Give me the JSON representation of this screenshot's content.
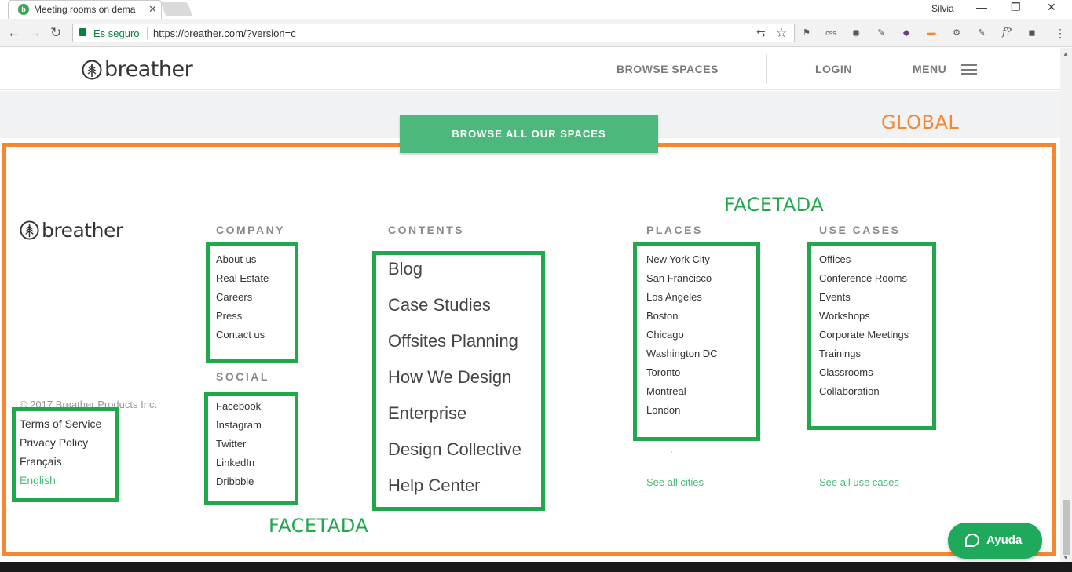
{
  "browser": {
    "tab_title": "Meeting rooms on dema",
    "tab_close": "✕",
    "window_user": "Silvia",
    "window_minimize": "—",
    "window_restore": "❐",
    "window_close": "✕",
    "back": "←",
    "forward": "→",
    "reload": "↻",
    "secure_label": "Es seguro",
    "url": "https://breather.com/?version=c",
    "translate_icon": "⇆",
    "bookmark_icon": "☆",
    "extensions": [
      "⚑",
      "css",
      "◉",
      "✎",
      "◆",
      "▬",
      "⚙",
      "✎",
      "f?",
      "◼",
      "⋮"
    ]
  },
  "header": {
    "logo_text": "breather",
    "browse_spaces": "BROWSE SPACES",
    "login": "LOGIN",
    "menu": "MENU"
  },
  "cta": {
    "browse_all": "BROWSE ALL OUR SPACES"
  },
  "footer": {
    "logo_text": "breather",
    "copyright": "© 2017 Breather Products Inc.",
    "legal": [
      "Terms of Service",
      "Privacy Policy",
      "Français",
      "English"
    ],
    "company": {
      "heading": "COMPANY",
      "items": [
        "About us",
        "Real Estate",
        "Careers",
        "Press",
        "Contact us"
      ]
    },
    "social": {
      "heading": "SOCIAL",
      "items": [
        "Facebook",
        "Instagram",
        "Twitter",
        "LinkedIn",
        "Dribbble"
      ]
    },
    "contents": {
      "heading": "CONTENTS",
      "items": [
        "Blog",
        "Case Studies",
        "Offsites Planning",
        "How We Design",
        "Enterprise",
        "Design Collective",
        "Help Center"
      ]
    },
    "places": {
      "heading": "PLACES",
      "items": [
        "New York City",
        "San Francisco",
        "Los Angeles",
        "Boston",
        "Chicago",
        "Washington DC",
        "Toronto",
        "Montreal",
        "London"
      ],
      "see_all": "See all cities"
    },
    "use_cases": {
      "heading": "USE CASES",
      "items": [
        "Offices",
        "Conference Rooms",
        "Events",
        "Workshops",
        "Corporate Meetings",
        "Trainings",
        "Classrooms",
        "Collaboration"
      ],
      "see_all": "See all use cases"
    }
  },
  "help_widget": {
    "label": "Ayuda"
  },
  "annotations": {
    "global": "GLOBAL",
    "facetada_top": "FACETADA",
    "facetada_bottom": "FACETADA",
    "orange_color": "#f58632",
    "green_color": "#20a94b"
  }
}
